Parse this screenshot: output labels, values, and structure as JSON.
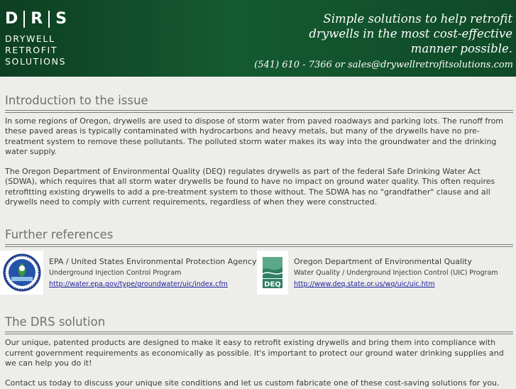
{
  "header": {
    "logo_letters": [
      "D",
      "R",
      "S"
    ],
    "logo_words": [
      "DRYWELL",
      "RETROFIT",
      "SOLUTIONS"
    ],
    "tagline": [
      "Simple solutions to help retrofit",
      "drywells in the most cost-effective",
      "manner possible."
    ],
    "contact": "(541) 610 - 7366 or sales@drywellretrofitsolutions.com"
  },
  "intro": {
    "title": "Introduction to the issue",
    "paragraphs": [
      "In some regions of Oregon, drywells are used to dispose of storm water from paved roadways and parking lots. The runoff from these paved areas is typically contaminated with hydrocarbons and heavy metals, but many of the drywells have no pre-treatment system to remove these pollutants. The polluted storm water makes its way into the groundwater and the drinking water supply.",
      "The Oregon Department of Environmental Quality (DEQ) regulates drywells as part of the federal Safe Drinking Water Act (SDWA), which requires that all storm water drywells be found to have no impact on ground water quality. This often requires retrofitting existing drywells to add a pre-treatment system to those without. The SDWA has no \"grandfather\" clause and all drywells need to comply with current requirements, regardless of when they were constructed."
    ]
  },
  "references": {
    "title": "Further references",
    "items": [
      {
        "org": "EPA / United States Environmental Protection Agency",
        "program": "Underground Injection Control Program",
        "url": "http://water.epa.gov/type/groundwater/uic/index.cfm",
        "logo_icon": "epa-seal-icon"
      },
      {
        "org": "Oregon Department of Environmental Quality",
        "program": "Water Quality / Underground Injection Control (UIC) Program",
        "url": "http://www.deq.state.or.us/wq/uic/uic.htm",
        "logo_icon": "deq-logo-icon",
        "logo_text": "DEQ"
      }
    ]
  },
  "solution": {
    "title": "The DRS solution",
    "paragraphs": [
      "Our unique, patented products are designed to make it easy to retrofit existing drywells and bring them into compliance with current government requirements as economically as possible. It's important to protect our ground water drinking supplies and we can help you do it!",
      "Contact us today to discuss your unique site conditions and let us custom fabricate one of these cost-saving solutions for you."
    ]
  },
  "colors": {
    "header_green": "#155a30",
    "background": "#edeeea",
    "heading_gray": "#6f6f6f",
    "link_blue": "#1b1b99",
    "deq_green": "#2f7f63"
  }
}
